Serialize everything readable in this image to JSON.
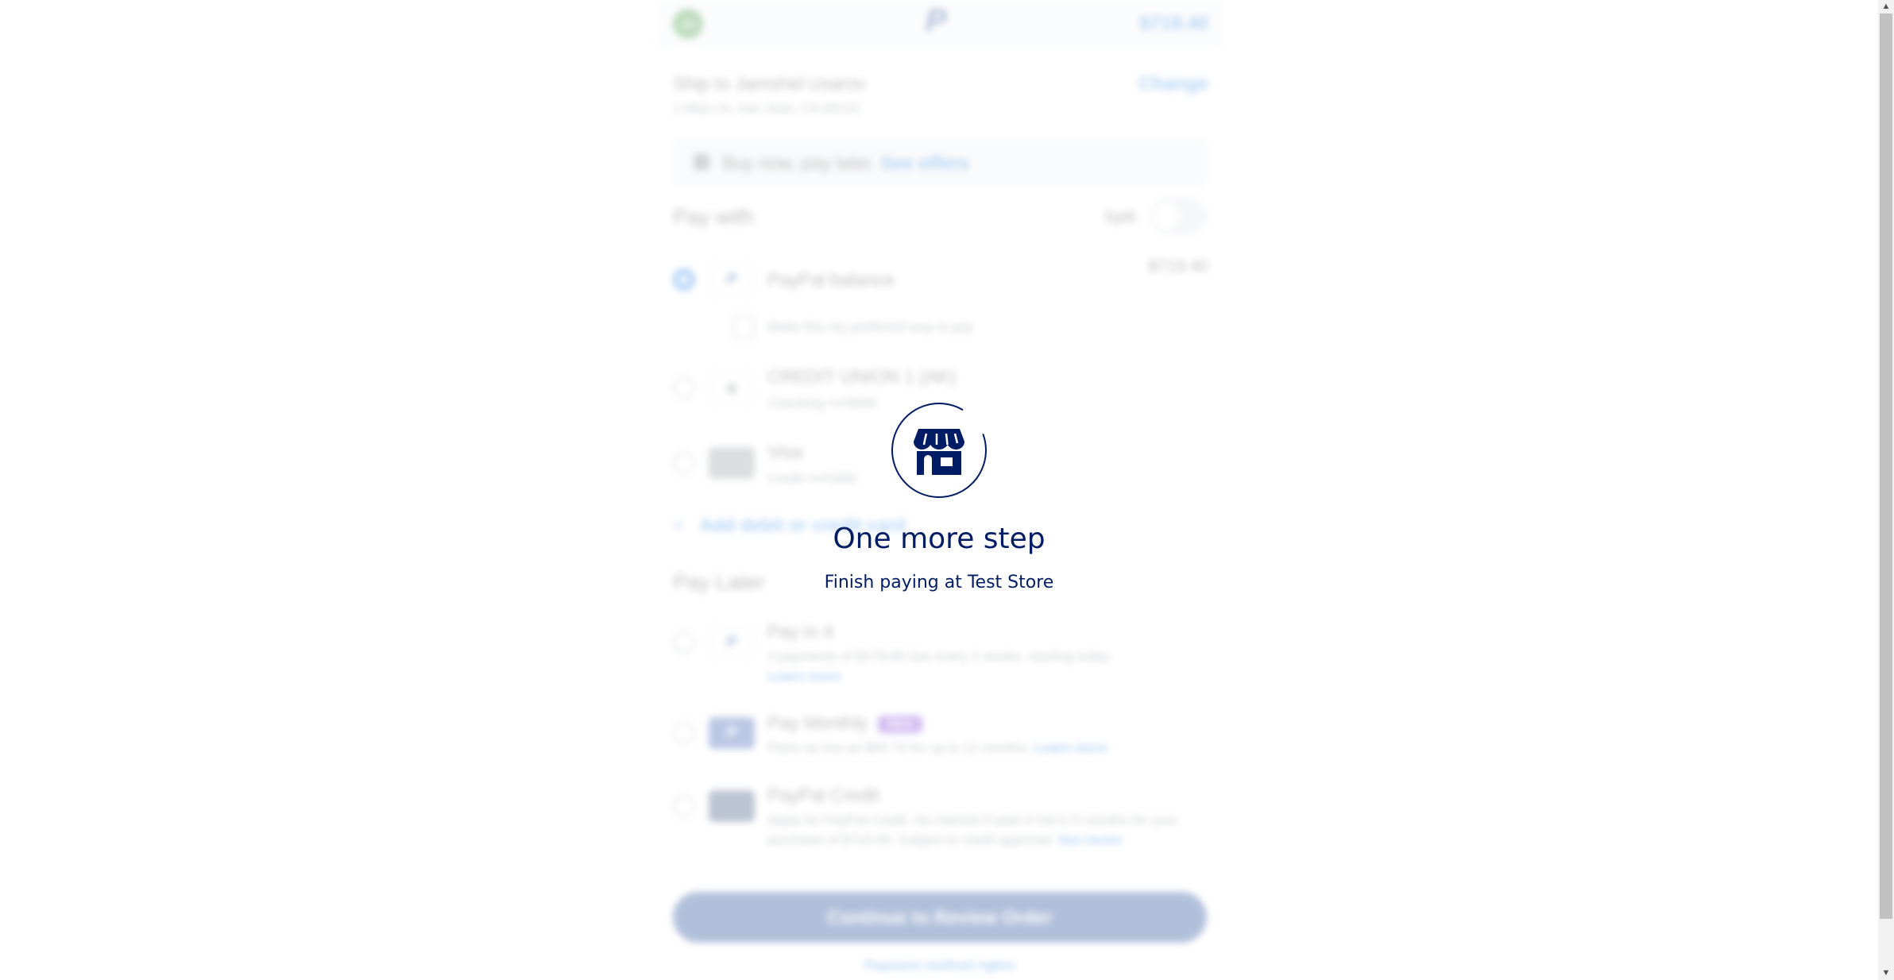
{
  "header": {
    "avatar_initials": "JU",
    "logo": "P",
    "total": "$719.40"
  },
  "shipping": {
    "title": "Ship to Jamshid Usarov",
    "address": "1 Main St, San Jose, CA 95131",
    "change_label": "Change"
  },
  "bnpl": {
    "text": "Buy now, pay later.",
    "link": "See offers"
  },
  "pay_with": {
    "title": "Pay with",
    "split_label": "Split",
    "split_on": false,
    "methods": [
      {
        "title": "PayPal balance",
        "subtitle": "",
        "amount": "$719.40",
        "selected": true
      },
      {
        "title": "CREDIT UNION 1 (AK)",
        "subtitle": "Checking ••••5656",
        "selected": false
      },
      {
        "title": "Visa",
        "subtitle": "Credit ••••5368",
        "selected": false
      }
    ],
    "preferred_label": "Make this my preferred way to pay",
    "add_card": "Add debit or credit card"
  },
  "pay_later": {
    "title": "Pay Later",
    "options": [
      {
        "title": "Pay in 4",
        "subtitle": "4 payments of $179.85 due every 2 weeks, starting today",
        "link": "Learn more"
      },
      {
        "title": "Pay Monthly",
        "badge": "New",
        "subtitle": "Plans as low as $65.74 for up to 12 months.",
        "link": "Learn more"
      },
      {
        "title": "PayPal Credit",
        "subtitle_line1": "Apply for PayPal Credit. No interest if paid in full in 6 months for your",
        "subtitle_line2": "purchase of $719.40. Subject to credit approval.",
        "link": "See terms"
      }
    ]
  },
  "continue_button": "Continue to Review Order",
  "footer_link": "Payment method rights",
  "overlay": {
    "icon": "store-icon",
    "title": "One more step",
    "subtitle": "Finish paying at Test Store"
  },
  "colors": {
    "accent": "#0070e0",
    "brand_navy": "#001c64",
    "paypal_blue": "#003087"
  }
}
